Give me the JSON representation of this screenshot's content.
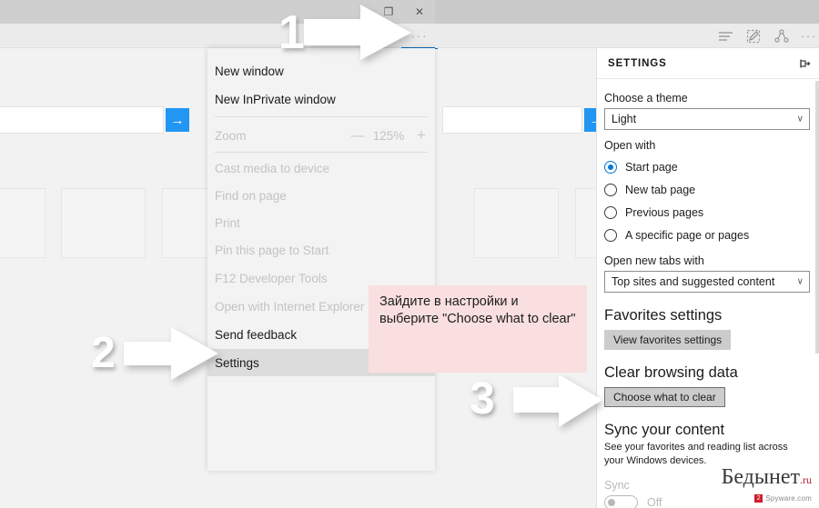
{
  "window_left": {
    "controls": [
      {
        "name": "restore",
        "glyph": "❐"
      },
      {
        "name": "close",
        "glyph": "✕"
      }
    ],
    "more_button": "···"
  },
  "window_right": {
    "controls": [
      {
        "name": "minimize",
        "glyph": "─"
      },
      {
        "name": "restore",
        "glyph": "❐"
      },
      {
        "name": "close",
        "glyph": "✕"
      }
    ],
    "toolbar_icons": [
      "reading-view-icon",
      "web-note-icon",
      "share-icon",
      "more-icon"
    ],
    "more_button": "···"
  },
  "menu": {
    "items": [
      {
        "label": "New window",
        "enabled": true
      },
      {
        "label": "New InPrivate window",
        "enabled": true
      },
      {
        "label": "Cast media to device",
        "enabled": false
      },
      {
        "label": "Find on page",
        "enabled": false
      },
      {
        "label": "Print",
        "enabled": false
      },
      {
        "label": "Pin this page to Start",
        "enabled": false
      },
      {
        "label": "F12 Developer Tools",
        "enabled": false
      },
      {
        "label": "Open with Internet Explorer",
        "enabled": false
      },
      {
        "label": "Send feedback",
        "enabled": true
      },
      {
        "label": "Settings",
        "enabled": true,
        "selected": true
      }
    ],
    "zoom": {
      "label": "Zoom",
      "minus": "—",
      "value": "125%",
      "plus": "+"
    }
  },
  "settings": {
    "title": "SETTINGS",
    "pin_icon": "pin-icon",
    "theme": {
      "label": "Choose a theme",
      "value": "Light",
      "chevron": "∨"
    },
    "open_with": {
      "label": "Open with",
      "options": [
        {
          "label": "Start page",
          "selected": true
        },
        {
          "label": "New tab page",
          "selected": false
        },
        {
          "label": "Previous pages",
          "selected": false
        },
        {
          "label": "A specific page or pages",
          "selected": false
        }
      ]
    },
    "new_tabs": {
      "label": "Open new tabs with",
      "value": "Top sites and suggested content",
      "chevron": "∨"
    },
    "favorites": {
      "heading": "Favorites settings",
      "button": "View favorites settings"
    },
    "clear_data": {
      "heading": "Clear browsing data",
      "button": "Choose what to clear"
    },
    "sync": {
      "heading": "Sync your content",
      "description": "See your favorites and reading list across your Windows devices.",
      "label": "Sync",
      "state": "Off"
    }
  },
  "callout": {
    "text": "Зайдите в настройки и выберите \"Choose what to clear\"",
    "background": "#f9dfe0"
  },
  "annotations": {
    "step1": "1",
    "step2": "2",
    "step3": "3"
  },
  "page_behind": {
    "search_go_glyph": "→",
    "accent": "#2196f3"
  },
  "watermark": {
    "name": "Бедынет",
    "tld": ".ru",
    "badge": "2",
    "sub": "Spyware.com"
  }
}
